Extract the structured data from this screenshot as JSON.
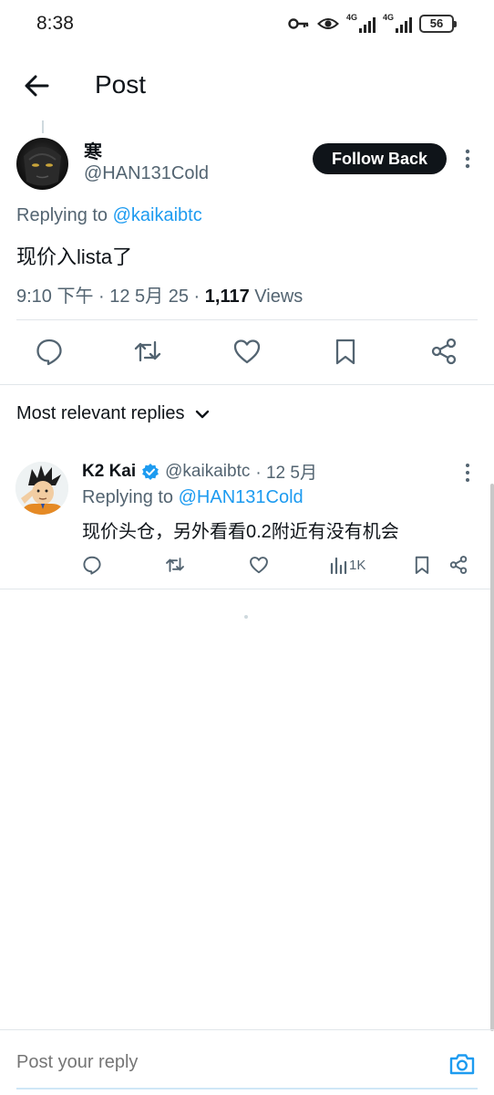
{
  "status_bar": {
    "time": "8:38",
    "signal_1_label": "4G",
    "signal_2_label": "4G",
    "battery": "56",
    "icons": [
      "key-icon",
      "eye-icon",
      "signal-icon",
      "signal-icon",
      "battery-icon"
    ]
  },
  "header": {
    "title": "Post",
    "back_icon": "arrow-left-icon"
  },
  "main_post": {
    "author_name": "寒",
    "author_handle": "@HAN131Cold",
    "follow_label": "Follow Back",
    "replying_prefix": "Replying to ",
    "replying_mention": "@kaikaibtc",
    "text": "现价入lista了",
    "timestamp": "9:10 下午 · 12 5月 25 · ",
    "views_count": "1,117",
    "views_label": " Views",
    "actions": [
      "reply-icon",
      "retweet-icon",
      "like-icon",
      "bookmark-icon",
      "share-icon"
    ]
  },
  "sort": {
    "label": "Most relevant replies",
    "icon": "chevron-down-icon"
  },
  "reply": {
    "author_name": "K2 Kai",
    "author_handle": "@kaikaibtc",
    "time": "· 12 5月",
    "replying_prefix": "Replying to ",
    "replying_mention": "@HAN131Cold",
    "text": "现价头仓，另外看看0.2附近有没有机会",
    "views": "1K",
    "verified": true
  },
  "composer": {
    "placeholder": "Post your reply",
    "icon": "camera-icon"
  },
  "colors": {
    "accent": "#1d9bf0",
    "text_primary": "#0f1419",
    "text_secondary": "#536471"
  }
}
